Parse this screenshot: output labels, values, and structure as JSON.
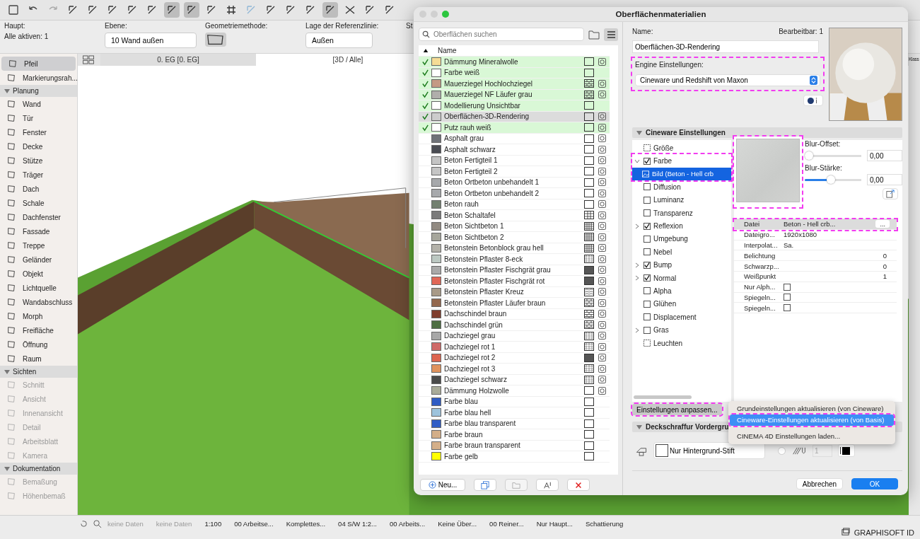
{
  "info_bar": {
    "main_label": "Haupt:",
    "active_label": "Alle aktiven: 1",
    "layer_label": "Ebene:",
    "layer_value": "10 Wand außen",
    "geometry_label": "Geometriemethode:",
    "refline_label": "Lage der Referenzlinie:",
    "refline_value": "Außen",
    "cut_label": "St"
  },
  "view_tabs": [
    {
      "label": "0. EG [0. EG]",
      "selected": false
    },
    {
      "label": "[3D / Alle]",
      "selected": true
    }
  ],
  "toolbox": {
    "top": [
      {
        "label": "Pfeil",
        "selected": true
      },
      {
        "label": "Markierungsrah...",
        "selected": false
      }
    ],
    "sections": [
      {
        "title": "Planung",
        "expanded": true,
        "items": [
          {
            "label": "Wand",
            "disabled": false
          },
          {
            "label": "Tür",
            "disabled": false
          },
          {
            "label": "Fenster",
            "disabled": false
          },
          {
            "label": "Decke",
            "disabled": false
          },
          {
            "label": "Stütze",
            "disabled": false
          },
          {
            "label": "Träger",
            "disabled": false
          },
          {
            "label": "Dach",
            "disabled": false
          },
          {
            "label": "Schale",
            "disabled": false
          },
          {
            "label": "Dachfenster",
            "disabled": false
          },
          {
            "label": "Fassade",
            "disabled": false
          },
          {
            "label": "Treppe",
            "disabled": false
          },
          {
            "label": "Geländer",
            "disabled": false
          },
          {
            "label": "Objekt",
            "disabled": false
          },
          {
            "label": "Lichtquelle",
            "disabled": false
          },
          {
            "label": "Wandabschluss",
            "disabled": false
          },
          {
            "label": "Morph",
            "disabled": false
          },
          {
            "label": "Freifläche",
            "disabled": false
          },
          {
            "label": "Öffnung",
            "disabled": false
          },
          {
            "label": "Raum",
            "disabled": false
          }
        ]
      },
      {
        "title": "Sichten",
        "expanded": true,
        "items": [
          {
            "label": "Schnitt",
            "disabled": true
          },
          {
            "label": "Ansicht",
            "disabled": true
          },
          {
            "label": "Innenansicht",
            "disabled": true
          },
          {
            "label": "Detail",
            "disabled": true
          },
          {
            "label": "Arbeitsblatt",
            "disabled": true
          },
          {
            "label": "Kamera",
            "disabled": true
          }
        ]
      },
      {
        "title": "Dokumentation",
        "expanded": true,
        "items": [
          {
            "label": "Bemaßung",
            "disabled": true
          },
          {
            "label": "Höhenbemaß",
            "disabled": true
          }
        ]
      }
    ]
  },
  "right_edge": {
    "label": "Klass"
  },
  "dialog": {
    "title": "Oberflächenmaterialien",
    "search": {
      "placeholder": "Oberflächen suchen"
    },
    "list_header": {
      "name": "Name"
    },
    "materials": [
      {
        "name": "Dämmung Mineralwolle",
        "checked": true,
        "selected": false,
        "color": "#f5dc95",
        "kind": "plain",
        "render": true
      },
      {
        "name": "Farbe weiß",
        "checked": true,
        "selected": false,
        "color": "#ffffff",
        "kind": "plain",
        "render": false
      },
      {
        "name": "Mauerziegel Hochlochziegel",
        "checked": true,
        "selected": false,
        "color": "#c49a84",
        "kind": "brick",
        "render": true
      },
      {
        "name": "Mauerziegel NF Läufer grau",
        "checked": true,
        "selected": false,
        "color": "#b0aeab",
        "kind": "brick",
        "render": true
      },
      {
        "name": "Modellierung Unsichtbar",
        "checked": true,
        "selected": false,
        "color": "#ffffff",
        "kind": "plain",
        "render": false
      },
      {
        "name": "Oberflächen-3D-Rendering",
        "checked": true,
        "selected": true,
        "color": "#cccccc",
        "kind": "plain",
        "render": true
      },
      {
        "name": "Putz rauh weiß",
        "checked": true,
        "selected": false,
        "color": "#ffffff",
        "kind": "plain",
        "render": true
      },
      {
        "name": "Asphalt grau",
        "checked": false,
        "selected": false,
        "color": "#6f7278",
        "kind": "plain",
        "render": true
      },
      {
        "name": "Asphalt schwarz",
        "checked": false,
        "selected": false,
        "color": "#4a4c53",
        "kind": "plain",
        "render": true
      },
      {
        "name": "Beton Fertigteil 1",
        "checked": false,
        "selected": false,
        "color": "#c4c4c4",
        "kind": "plain",
        "render": true
      },
      {
        "name": "Beton Fertigteil 2",
        "checked": false,
        "selected": false,
        "color": "#c5c5c5",
        "kind": "plain",
        "render": true
      },
      {
        "name": "Beton Ortbeton unbehandelt 1",
        "checked": false,
        "selected": false,
        "color": "#a6a8ab",
        "kind": "plain",
        "render": true
      },
      {
        "name": "Beton Ortbeton unbehandelt 2",
        "checked": false,
        "selected": false,
        "color": "#a7a9ac",
        "kind": "plain",
        "render": true
      },
      {
        "name": "Beton rauh",
        "checked": false,
        "selected": false,
        "color": "#738070",
        "kind": "plain",
        "render": true
      },
      {
        "name": "Beton Schaltafel",
        "checked": false,
        "selected": false,
        "color": "#7b7b7b",
        "kind": "grid",
        "render": true
      },
      {
        "name": "Beton Sichtbeton 1",
        "checked": false,
        "selected": false,
        "color": "#918a82",
        "kind": "finegrid",
        "render": true
      },
      {
        "name": "Beton Sichtbeton 2",
        "checked": false,
        "selected": false,
        "color": "#a6a69c",
        "kind": "finegrid",
        "render": true
      },
      {
        "name": "Betonstein Betonblock grau hell",
        "checked": false,
        "selected": false,
        "color": "#b4b2aa",
        "kind": "finegrid",
        "render": true
      },
      {
        "name": "Betonstein Pflaster 8-eck",
        "checked": false,
        "selected": false,
        "color": "#bcc8c2",
        "kind": "tile",
        "render": true
      },
      {
        "name": "Betonstein Pflaster Fischgrät grau",
        "checked": false,
        "selected": false,
        "color": "#a9a9a9",
        "kind": "dense",
        "render": true
      },
      {
        "name": "Betonstein Pflaster Fischgrät rot",
        "checked": false,
        "selected": false,
        "color": "#e06757",
        "kind": "dense",
        "render": true
      },
      {
        "name": "Betonstein Pflaster Kreuz",
        "checked": false,
        "selected": false,
        "color": "#a89a88",
        "kind": "hex",
        "render": true
      },
      {
        "name": "Betonstein Pflaster Läufer braun",
        "checked": false,
        "selected": false,
        "color": "#93684e",
        "kind": "brick",
        "render": true
      },
      {
        "name": "Dachschindel braun",
        "checked": false,
        "selected": false,
        "color": "#7f3e2e",
        "kind": "brick",
        "render": true
      },
      {
        "name": "Dachschindel grün",
        "checked": false,
        "selected": false,
        "color": "#4e6e43",
        "kind": "brick",
        "render": true
      },
      {
        "name": "Dachziegel grau",
        "checked": false,
        "selected": false,
        "color": "#a7a7a7",
        "kind": "tile",
        "render": true
      },
      {
        "name": "Dachziegel rot 1",
        "checked": false,
        "selected": false,
        "color": "#cf6a68",
        "kind": "tile",
        "render": true
      },
      {
        "name": "Dachziegel rot 2",
        "checked": false,
        "selected": false,
        "color": "#dd6550",
        "kind": "dense",
        "render": true
      },
      {
        "name": "Dachziegel rot 3",
        "checked": false,
        "selected": false,
        "color": "#e0935e",
        "kind": "tile",
        "render": true
      },
      {
        "name": "Dachziegel schwarz",
        "checked": false,
        "selected": false,
        "color": "#4a4a4a",
        "kind": "tile",
        "render": true
      },
      {
        "name": "Dämmung Holzwolle",
        "checked": false,
        "selected": false,
        "color": "#a9ab98",
        "kind": "plain",
        "render": true
      },
      {
        "name": "Farbe blau",
        "checked": false,
        "selected": false,
        "color": "#2f5cc4",
        "kind": "plain",
        "render": false
      },
      {
        "name": "Farbe blau hell",
        "checked": false,
        "selected": false,
        "color": "#9dc3dc",
        "kind": "plain",
        "render": false
      },
      {
        "name": "Farbe blau transparent",
        "checked": false,
        "selected": false,
        "color": "#305dc5",
        "kind": "plain",
        "render": false
      },
      {
        "name": "Farbe braun",
        "checked": false,
        "selected": false,
        "color": "#d3ae88",
        "kind": "plain",
        "render": false
      },
      {
        "name": "Farbe braun transparent",
        "checked": false,
        "selected": false,
        "color": "#d4af89",
        "kind": "plain",
        "render": false
      },
      {
        "name": "Farbe gelb",
        "checked": false,
        "selected": false,
        "color": "#ffff00",
        "kind": "plain",
        "render": false
      }
    ],
    "new_button": "Neu...",
    "name_label": "Name:",
    "editable_label": "Bearbeitbar: 1",
    "name_value": "Oberflächen-3D-Rendering",
    "engine": {
      "label": "Engine Einstellungen:",
      "value": "Cineware und Redshift von Maxon",
      "highlighted": true
    },
    "cineware_header": "Cineware Einstellungen",
    "channels": [
      {
        "label": "Größe",
        "kind": "icon",
        "selected": false
      },
      {
        "label": "Farbe",
        "kind": "checkbox",
        "checked": true,
        "expanded": true,
        "selected": false,
        "highlighted": true,
        "children": [
          {
            "label": "Bild (Beton - Hell crb",
            "kind": "image",
            "selected": true
          }
        ]
      },
      {
        "label": "Diffusion",
        "kind": "checkbox",
        "checked": false,
        "selected": false
      },
      {
        "label": "Luminanz",
        "kind": "checkbox",
        "checked": false,
        "selected": false
      },
      {
        "label": "Transparenz",
        "kind": "checkbox",
        "checked": false,
        "selected": false
      },
      {
        "label": "Reflexion",
        "kind": "checkbox",
        "checked": true,
        "expanded": false,
        "selected": false
      },
      {
        "label": "Umgebung",
        "kind": "checkbox",
        "checked": false,
        "selected": false
      },
      {
        "label": "Nebel",
        "kind": "checkbox",
        "checked": false,
        "selected": false
      },
      {
        "label": "Bump",
        "kind": "checkbox",
        "checked": true,
        "expanded": false,
        "selected": false
      },
      {
        "label": "Normal",
        "kind": "checkbox",
        "checked": true,
        "expanded": false,
        "selected": false
      },
      {
        "label": "Alpha",
        "kind": "checkbox",
        "checked": false,
        "selected": false
      },
      {
        "label": "Glühen",
        "kind": "checkbox",
        "checked": false,
        "selected": false
      },
      {
        "label": "Displacement",
        "kind": "checkbox",
        "checked": false,
        "selected": false
      },
      {
        "label": "Gras",
        "kind": "checkbox",
        "checked": false,
        "expanded": false,
        "selected": false
      },
      {
        "label": "Leuchten",
        "kind": "icon",
        "selected": false
      }
    ],
    "texture_highlighted": true,
    "sliders": [
      {
        "label": "Blur-Offset:",
        "level": 0.0,
        "reading": "0,00"
      },
      {
        "label": "Blur-Stärke:",
        "level": 0.45,
        "reading": "0,00"
      }
    ],
    "properties": [
      {
        "label": "Datei",
        "value": "Beton - Hell crb...",
        "kind": "file",
        "button": "...",
        "highlighted": true
      },
      {
        "label": "Dateigro...",
        "value": "1920x1080",
        "kind": "text"
      },
      {
        "label": "Interpolat...",
        "value": "Sa.",
        "kind": "text"
      },
      {
        "label": "Belichtung",
        "value": "0",
        "kind": "number"
      },
      {
        "label": "Schwarzp...",
        "value": "0",
        "kind": "number"
      },
      {
        "label": "Weißpunkt",
        "value": "1",
        "kind": "number"
      },
      {
        "label": "Nur Alph...",
        "kind": "checkbox",
        "checked": false
      },
      {
        "label": "Spiegeln...",
        "kind": "checkbox",
        "checked": false
      },
      {
        "label": "Spiegeln...",
        "kind": "checkbox",
        "checked": false
      }
    ],
    "adjust_button": {
      "label": "Einstellungen anpassen...",
      "highlighted": true
    },
    "menu": [
      {
        "label": "Grundeinstellungen aktualisieren (von Cineware)",
        "selected": false,
        "highlighted": false
      },
      {
        "label": "Cineware-Einstellungen aktualisieren (von Basis)",
        "selected": true,
        "highlighted": true
      },
      {
        "label": "CINEMA 4D Einstellungen laden...",
        "selected": false,
        "highlighted": false
      }
    ],
    "hatch_header": "Deckschraffur Vordergru",
    "pen_value": "Nur Hintergrund-Stift",
    "pen_radio": {
      "selected": false
    },
    "pen_number": "1",
    "cancel": "Abbrechen",
    "ok": "OK"
  },
  "status_bar": [
    {
      "text": "keine Daten",
      "disabled": true
    },
    {
      "text": "keine Daten",
      "disabled": true
    },
    {
      "text": "1:100",
      "disabled": false
    },
    {
      "text": "00 Arbeitse...",
      "disabled": false
    },
    {
      "text": "Komplettes...",
      "disabled": false
    },
    {
      "text": "04 S/W 1:2...",
      "disabled": false
    },
    {
      "text": "00 Arbeits...",
      "disabled": false
    },
    {
      "text": "Keine Über...",
      "disabled": false
    },
    {
      "text": "00 Reiner...",
      "disabled": false
    },
    {
      "text": "Nur Haupt...",
      "disabled": false
    },
    {
      "text": "Schattierung",
      "disabled": false
    }
  ],
  "brand": "GRAPHISOFT ID"
}
